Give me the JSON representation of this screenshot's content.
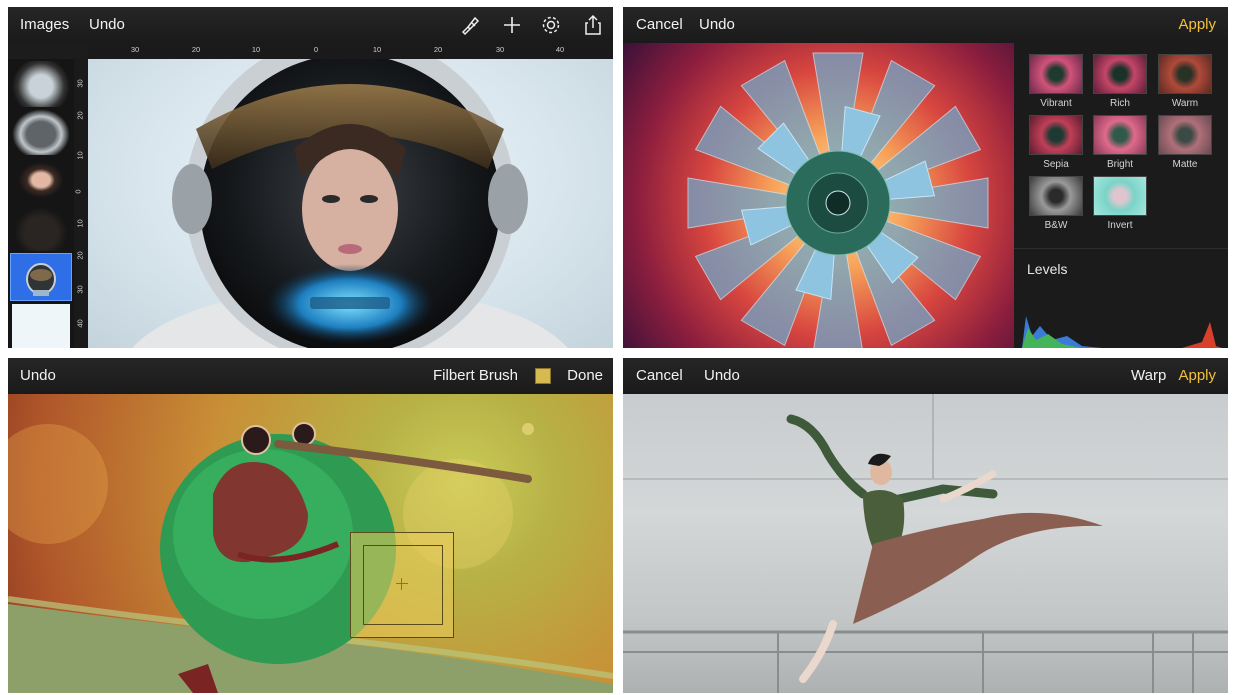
{
  "panel1": {
    "topbar": {
      "images_label": "Images",
      "undo_label": "Undo"
    },
    "icons": [
      "brush-icon",
      "plus-icon",
      "settings-icon",
      "share-icon"
    ],
    "ruler_top": [
      "30",
      "20",
      "10",
      "0",
      "10",
      "20",
      "30",
      "40"
    ],
    "ruler_left": [
      "30",
      "20",
      "10",
      "0",
      "10",
      "20",
      "30",
      "40"
    ]
  },
  "panel2": {
    "topbar": {
      "cancel_label": "Cancel",
      "undo_label": "Undo",
      "apply_label": "Apply"
    },
    "filters": [
      {
        "label": "Vibrant",
        "tone": "#d2527a"
      },
      {
        "label": "Rich",
        "tone": "#c64568"
      },
      {
        "label": "Warm",
        "tone": "#b04a3a"
      },
      {
        "label": "Sepia",
        "tone": "#c23f58"
      },
      {
        "label": "Bright",
        "tone": "#e06a8c"
      },
      {
        "label": "Matte",
        "tone": "#b0707a"
      },
      {
        "label": "B&W",
        "tone": "#777777"
      },
      {
        "label": "Invert",
        "tone": "#7ad4c8"
      }
    ],
    "levels_label": "Levels"
  },
  "panel3": {
    "topbar": {
      "undo_label": "Undo",
      "brush_label": "Filbert Brush",
      "done_label": "Done"
    },
    "swatch_color": "#d8b94f"
  },
  "panel4": {
    "topbar": {
      "cancel_label": "Cancel",
      "undo_label": "Undo",
      "warp_label": "Warp",
      "apply_label": "Apply"
    }
  },
  "colors": {
    "accent": "#f3c13a",
    "bar": "#1f1f1f"
  }
}
